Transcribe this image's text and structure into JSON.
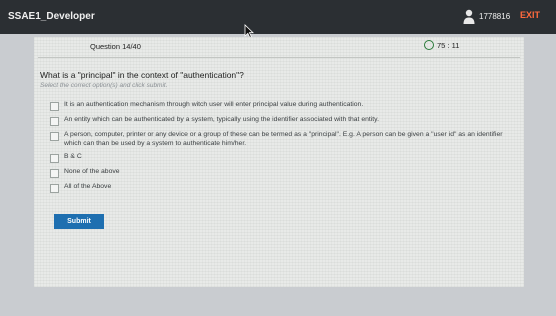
{
  "header": {
    "app_title": "SSAE1_Developer",
    "user_id": "1778816",
    "exit_label": "EXIT",
    "user_icon": "user-icon",
    "colors": {
      "bar": "#2b2f33",
      "exit": "#ff6a3d"
    }
  },
  "question_header": {
    "label": "Question 14/40",
    "timer_icon": "clock-icon",
    "timer": "75 : 11"
  },
  "question": {
    "text": "What is a \"principal\" in the context of \"authentication\"?",
    "instruction": "Select the correct option(s) and click submit."
  },
  "options": [
    {
      "text": "It is an authentication mechanism through witch user will enter principal value during authentication."
    },
    {
      "text": "An entity which can be authenticated by a system, typically using the identifier associated with that entity."
    },
    {
      "text": "A person, computer, printer or any device or a group of these can be termed as a \"principal\". E.g. A person can be given a \"user id\" as an identifier which can than be used by a system to authenticate him/her."
    },
    {
      "text": "B & C"
    },
    {
      "text": "None of the above"
    },
    {
      "text": "All of the Above"
    }
  ],
  "submit": {
    "label": "Submit",
    "color": "#1e6fb0"
  }
}
